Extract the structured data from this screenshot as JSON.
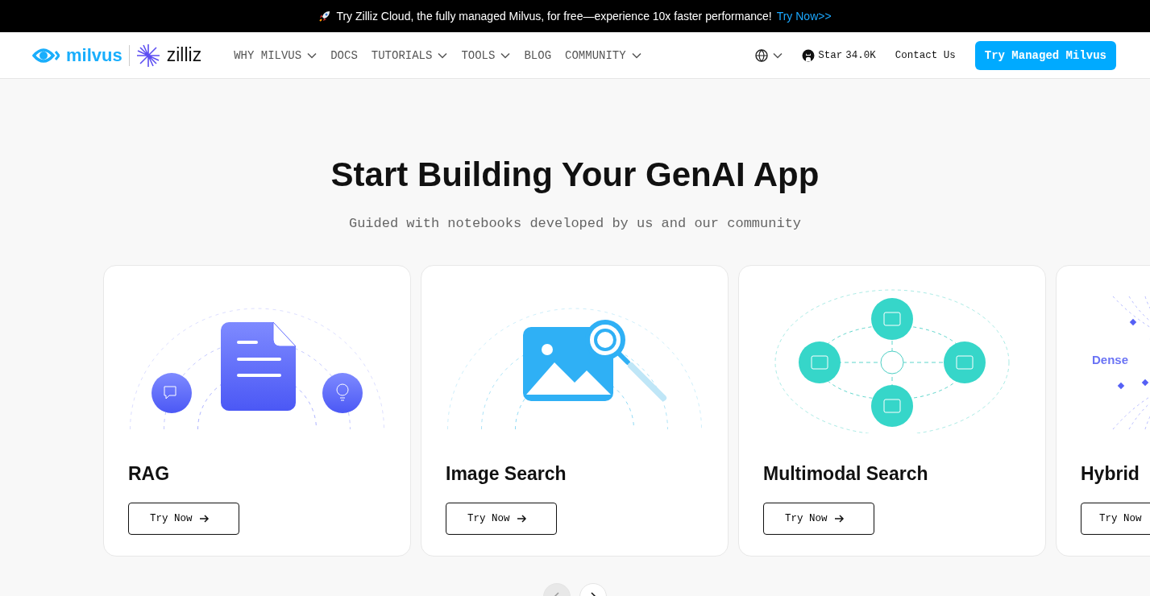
{
  "banner": {
    "text": "Try Zilliz Cloud, the fully managed Milvus, for free—experience 10x faster performance!",
    "link": "Try Now>>"
  },
  "nav": {
    "logo": "milvus",
    "partner_logo": "zilliz",
    "items": [
      {
        "label": "WHY MILVUS",
        "dropdown": true
      },
      {
        "label": "DOCS",
        "dropdown": false
      },
      {
        "label": "TUTORIALS",
        "dropdown": true
      },
      {
        "label": "TOOLS",
        "dropdown": true
      },
      {
        "label": "BLOG",
        "dropdown": false
      },
      {
        "label": "COMMUNITY",
        "dropdown": true
      }
    ],
    "github": {
      "label": "Star",
      "count": "34.0K"
    },
    "contact": "Contact Us",
    "cta": "Try Managed Milvus"
  },
  "hero": {
    "title": "Start Building Your GenAI App",
    "subtitle": "Guided with notebooks developed by us and our community"
  },
  "cards": [
    {
      "kind": "rag",
      "title": "RAG",
      "button": "Try Now",
      "arrow": true
    },
    {
      "kind": "image",
      "title": "Image Search",
      "button": "Try Now",
      "arrow": true
    },
    {
      "kind": "multimodal",
      "title": "Multimodal Search",
      "button": "Try Now",
      "arrow": true
    },
    {
      "kind": "hybrid",
      "title": "Hybrid",
      "button": "Try Now",
      "arrow": false,
      "label": "Dense"
    }
  ],
  "carousel": {
    "prev_disabled": true,
    "next_disabled": false
  }
}
